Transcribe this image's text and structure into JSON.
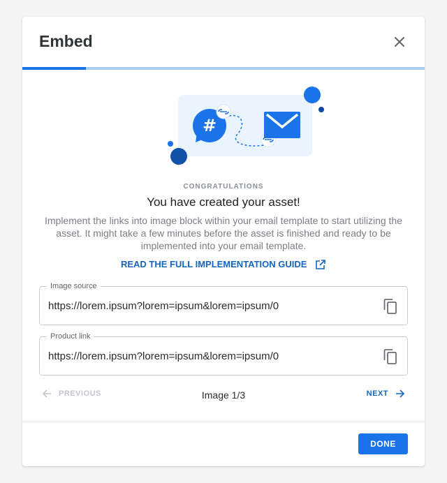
{
  "dialog": {
    "title": "Embed",
    "progress_fraction": 0.1575,
    "colors": {
      "accent": "#1a73e8",
      "track": "#a9ccf2",
      "link": "#1565c0",
      "illustration_bg": "#eaf4ff"
    }
  },
  "success": {
    "eyebrow": "CONGRATULATIONS",
    "headline": "You have created your asset!",
    "description": "Implement the links into image block within your email template to start utilizing the asset. It might take a few minutes before the asset is finished and ready to be implemented into your email template.",
    "guide_link": "READ THE FULL IMPLEMENTATION GUIDE"
  },
  "fields": {
    "image_source": {
      "label": "Image source",
      "value": "https://lorem.ipsum?lorem=ipsum&lorem=ipsum/0"
    },
    "product_link": {
      "label": "Product link",
      "value": "https://lorem.ipsum?lorem=ipsum&lorem=ipsum/0"
    }
  },
  "pagination": {
    "previous": "PREVIOUS",
    "status": "Image 1/3",
    "next": "NEXT"
  },
  "footer": {
    "done": "DONE"
  },
  "icons": [
    "close-icon",
    "hashtag-icon",
    "link-icon",
    "mail-icon",
    "external-link-icon",
    "copy-icon",
    "arrow-left-icon",
    "arrow-right-icon"
  ]
}
